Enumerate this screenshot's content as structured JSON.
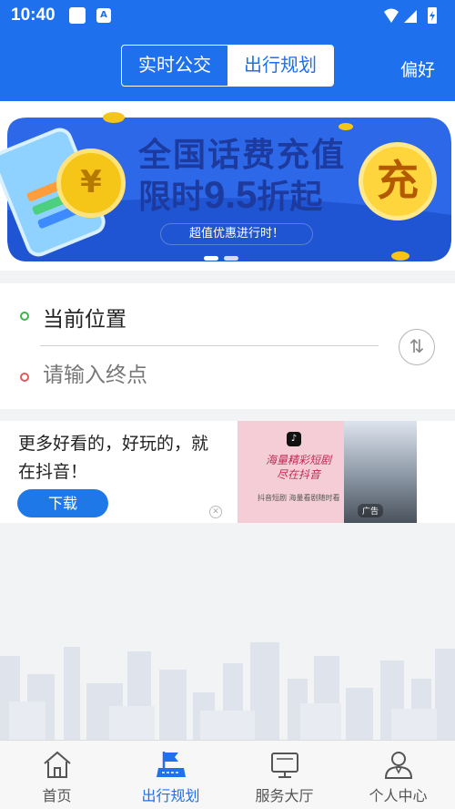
{
  "status_bar": {
    "time": "10:40",
    "badge": "A"
  },
  "header": {
    "segments": [
      {
        "label": "实时公交",
        "active": false
      },
      {
        "label": "出行规划",
        "active": true
      }
    ],
    "preference_label": "偏好",
    "accent_color": "#1f70ec"
  },
  "banner": {
    "title": "全国话费充值",
    "subtitle_prefix": "限时",
    "subtitle_number": "9.5",
    "subtitle_suffix": "折起",
    "pill_text": "超值优惠进行时！",
    "coin_glyph": "¥",
    "badge_glyph": "充",
    "active_slide": 1,
    "slide_count": 2
  },
  "route": {
    "origin_label": "当前位置",
    "destination_placeholder": "请输入终点",
    "swap_glyph": "⇅"
  },
  "ad": {
    "text": "更多好看的，好玩的，就在抖音！",
    "button_label": "下载",
    "close_glyph": "✕",
    "image": {
      "headline": "海量精彩短剧 尽在抖音",
      "footer_text": "抖音短剧  海量看剧随时看",
      "tag": "广告"
    }
  },
  "tabbar": {
    "items": [
      {
        "label": "首页",
        "icon": "home-icon",
        "active": false
      },
      {
        "label": "出行规划",
        "icon": "route-plan-icon",
        "active": true
      },
      {
        "label": "服务大厅",
        "icon": "service-hall-icon",
        "active": false
      },
      {
        "label": "个人中心",
        "icon": "person-icon",
        "active": false
      }
    ]
  }
}
